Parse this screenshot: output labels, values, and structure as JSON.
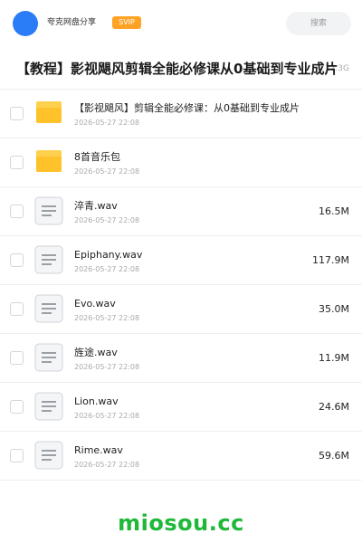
{
  "header": {
    "share_name": "夸克网盘分享",
    "badge": "SVIP",
    "search_label": "搜索"
  },
  "folder": {
    "title": "【教程】影视飓风剪辑全能必修课从0基础到专业成片",
    "total_size": "12.3G"
  },
  "items": [
    {
      "type": "folder",
      "name": "【影视飓风】剪辑全能必修课：从0基础到专业成片",
      "date": "2026-05-27 22:08",
      "size": ""
    },
    {
      "type": "folder",
      "name": "8首音乐包",
      "date": "2026-05-27 22:08",
      "size": ""
    },
    {
      "type": "file",
      "name": "淬青.wav",
      "date": "2026-05-27 22:08",
      "size": "16.5M"
    },
    {
      "type": "file",
      "name": "Epiphany.wav",
      "date": "2026-05-27 22:08",
      "size": "117.9M"
    },
    {
      "type": "file",
      "name": "Evo.wav",
      "date": "2026-05-27 22:08",
      "size": "35.0M"
    },
    {
      "type": "file",
      "name": "旌途.wav",
      "date": "2026-05-27 22:08",
      "size": "11.9M"
    },
    {
      "type": "file",
      "name": "Lion.wav",
      "date": "2026-05-27 22:08",
      "size": "24.6M"
    },
    {
      "type": "file",
      "name": "Rime.wav",
      "date": "2026-05-27 22:08",
      "size": "59.6M"
    }
  ],
  "watermark": "miosou.cc",
  "colors": {
    "avatar": "#2b7cf7",
    "svip_badge": "#ffa326",
    "folder_icon": "#ffc53d",
    "watermark": "#1fb838"
  }
}
